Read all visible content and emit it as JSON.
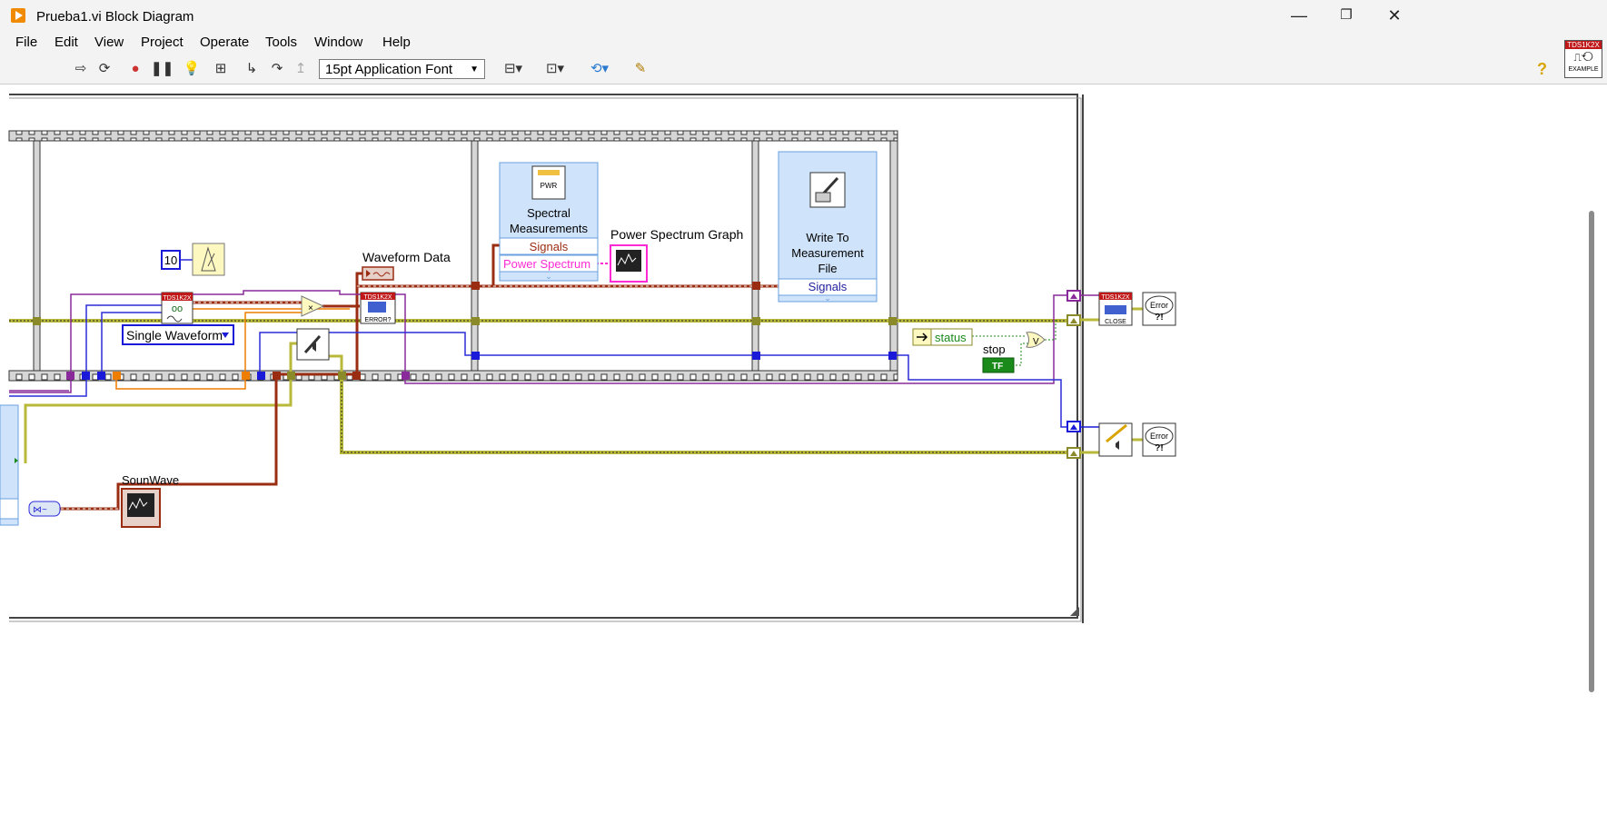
{
  "window": {
    "title": "Prueba1.vi Block Diagram",
    "minimize": "—",
    "maximize": "❐",
    "close": "✕"
  },
  "menu": [
    "File",
    "Edit",
    "View",
    "Project",
    "Operate",
    "Tools",
    "Window",
    "Help"
  ],
  "toolbar": {
    "font": "15pt Application Font",
    "help": "?"
  },
  "vi_icon": {
    "header": "TDS1K2X",
    "footer": "EXAMPLE"
  },
  "diagram": {
    "constant_value": "10",
    "waveform_data_label": "Waveform Data",
    "single_waveform": "Single Waveform",
    "spectral": {
      "title_line1": "Spectral",
      "title_line2": "Measurements",
      "output1": "Signals",
      "output2": "Power Spectrum"
    },
    "power_spectrum_graph_label": "Power Spectrum Graph",
    "write_file": {
      "title_line1": "Write To",
      "title_line2": "Measurement",
      "title_line3": "File",
      "input": "Signals"
    },
    "status_label": "status",
    "stop_label": "stop",
    "stop_terminal": "TF",
    "or_label": "V",
    "sounwave_label": "SounWave",
    "tds_close": "CLOSE",
    "tds_error": "ERROR?",
    "tds_header": "TDS1K2X",
    "error_text": "Error",
    "error_marks": "?!",
    "pwr": "PWR"
  },
  "colors": {
    "error_wire": "#b8b83a",
    "waveform_wire": "#9a2c12",
    "refnum_wire": "#7a2a8a",
    "numeric_wire": "#2b2bd8",
    "float_wire": "#ef7d00",
    "express_node": "#cfe3fa",
    "boolean": "#1a8a1a"
  }
}
